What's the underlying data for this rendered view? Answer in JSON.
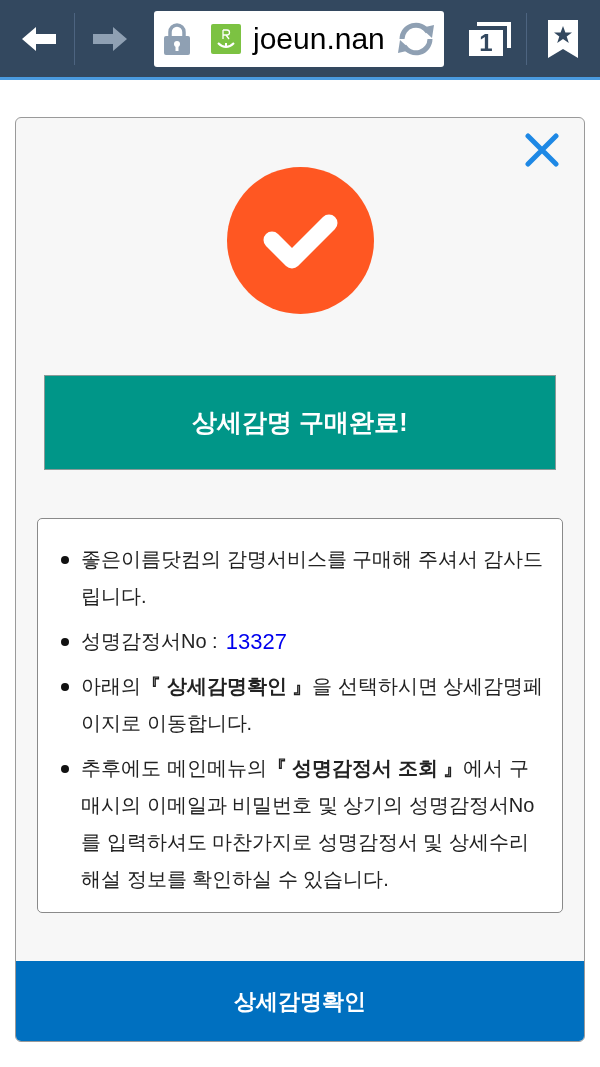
{
  "browser": {
    "back": {
      "disabled": false
    },
    "forward": {
      "disabled": true
    },
    "url": "joeun.nan",
    "tab_count": "1"
  },
  "dialog": {
    "title": "상세감명 구매완료!",
    "items": [
      {
        "kind": "text",
        "text": "좋은이름닷컴의 감명서비스를 구매해 주셔서 감사드립니다."
      },
      {
        "kind": "field",
        "label": "성명감정서No :",
        "value": "13327"
      },
      {
        "kind": "text",
        "text": "아래의**『 상세감명확인 』**을 선택하시면 상세감명페이지로 이동합니다."
      },
      {
        "kind": "text",
        "text": "추후에도 메인메뉴의**『 성명감정서 조회 』**에서 구매시의 이메일과 비밀번호 및 상기의 성명감정서No를 입력하셔도 마찬가지로 성명감정서 및 상세수리해설 정보를 확인하실 수 있습니다."
      }
    ],
    "button": "상세감명확인"
  }
}
